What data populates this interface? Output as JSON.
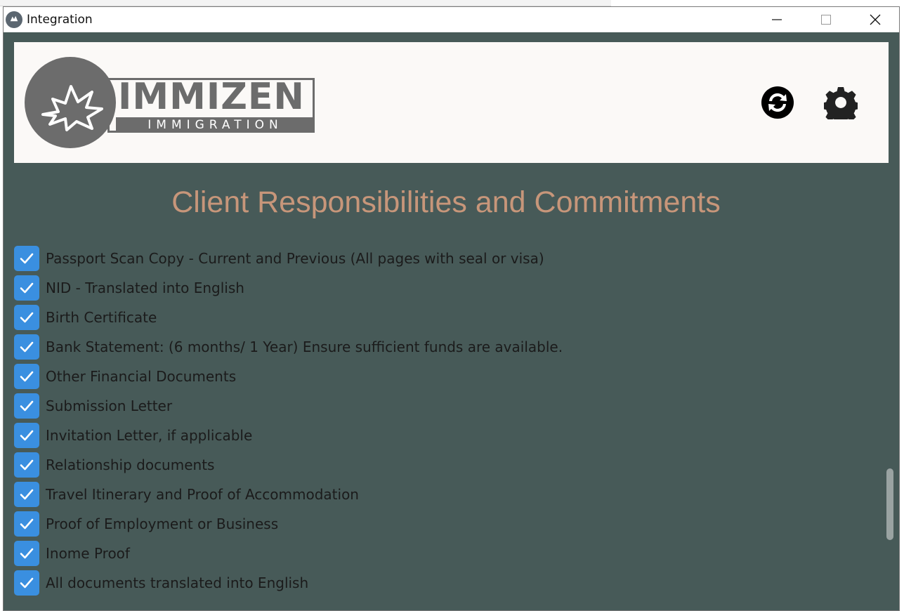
{
  "window": {
    "title": "Integration"
  },
  "logo": {
    "name": "IMMIZEN",
    "tagline": "IMMIGRATION"
  },
  "header_icons": [
    "sync-icon",
    "gear-icon"
  ],
  "heading": "Client Responsibilities and Commitments",
  "checklist": [
    {
      "label": "Passport Scan Copy - Current and Previous (All pages with seal or visa)",
      "checked": true
    },
    {
      "label": "NID - Translated into English",
      "checked": true
    },
    {
      "label": "Birth Certificate",
      "checked": true
    },
    {
      "label": "Bank Statement: (6 months/ 1 Year) Ensure sufficient funds are available.",
      "checked": true
    },
    {
      "label": "Other Financial Documents",
      "checked": true
    },
    {
      "label": "Submission Letter",
      "checked": true
    },
    {
      "label": "Invitation Letter, if applicable",
      "checked": true
    },
    {
      "label": "Relationship documents",
      "checked": true
    },
    {
      "label": "Travel Itinerary and Proof of Accommodation",
      "checked": true
    },
    {
      "label": "Proof of Employment or Business",
      "checked": true
    },
    {
      "label": "Inome Proof",
      "checked": true
    },
    {
      "label": "All documents translated into English",
      "checked": true
    }
  ],
  "colors": {
    "window_bg": "#475a58",
    "banner_bg": "#fbf9f7",
    "heading": "#c7967a",
    "checkbox": "#3a8fe0",
    "logo_gray": "#6c6c6c"
  }
}
